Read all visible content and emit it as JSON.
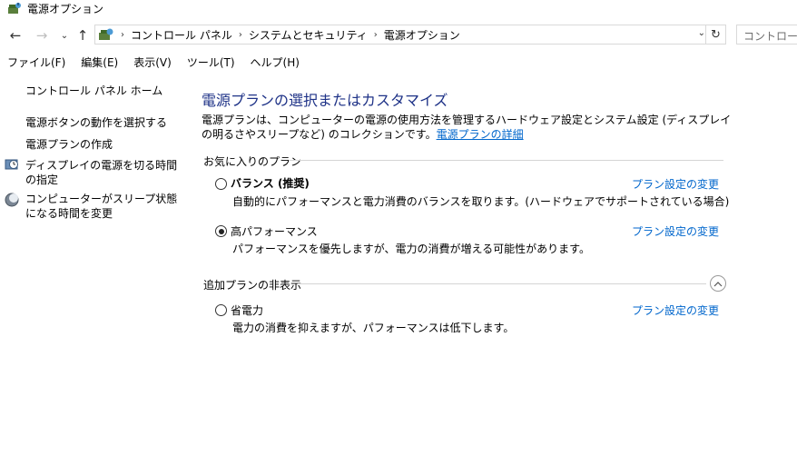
{
  "window": {
    "title": "電源オプション"
  },
  "address": {
    "crumbs": [
      "コントロール パネル",
      "システムとセキュリティ",
      "電源オプション"
    ],
    "search_placeholder": "コントロール パ"
  },
  "menu": [
    "ファイル(F)",
    "編集(E)",
    "表示(V)",
    "ツール(T)",
    "ヘルプ(H)"
  ],
  "sidebar": {
    "home": "コントロール パネル ホーム",
    "links": [
      "電源ボタンの動作を選択する",
      "電源プランの作成",
      "ディスプレイの電源を切る時間の指定",
      "コンピューターがスリープ状態になる時間を変更"
    ],
    "icons": [
      "",
      "",
      "clock-power-icon",
      "moon-sleep-icon"
    ]
  },
  "main": {
    "title": "電源プランの選択またはカスタマイズ",
    "description": "電源プランは、コンピューターの電源の使用方法を管理するハードウェア設定とシステム設定 (ディスプレイの明るさやスリープなど) のコレクションです。",
    "details_link": "電源プランの詳細",
    "favorites_header": "お気に入りのプラン",
    "hidden_header": "追加プランの非表示",
    "change_link": "プラン設定の変更",
    "plans": [
      {
        "name": "バランス (推奨)",
        "desc": "自動的にパフォーマンスと電力消費のバランスを取ります。(ハードウェアでサポートされている場合)",
        "selected": false
      },
      {
        "name": "高パフォーマンス",
        "desc": "パフォーマンスを優先しますが、電力の消費が増える可能性があります。",
        "selected": true
      },
      {
        "name": "省電力",
        "desc": "電力の消費を抑えますが、パフォーマンスは低下します。",
        "selected": false
      }
    ]
  },
  "colors": {
    "title": "#1e3287",
    "link": "#0066cc"
  }
}
